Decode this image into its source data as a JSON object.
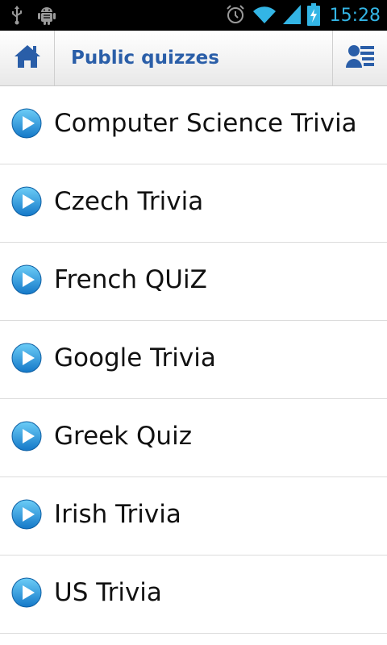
{
  "status_bar": {
    "left_icons": [
      "usb-icon",
      "android-debug-icon"
    ],
    "right_icons": [
      "alarm-icon",
      "wifi-icon",
      "signal-icon",
      "battery-charging-icon"
    ],
    "time": "15:28",
    "accent_color": "#33b5e5"
  },
  "action_bar": {
    "title": "Public quizzes",
    "home_icon": "home-icon",
    "menu_icon": "user-list-icon",
    "title_color": "#2a5ea8"
  },
  "quizzes": [
    {
      "label": "Computer Science Trivia",
      "icon": "play-icon"
    },
    {
      "label": "Czech Trivia",
      "icon": "play-icon"
    },
    {
      "label": "French QUiZ",
      "icon": "play-icon"
    },
    {
      "label": "Google Trivia",
      "icon": "play-icon"
    },
    {
      "label": "Greek Quiz",
      "icon": "play-icon"
    },
    {
      "label": "Irish Trivia",
      "icon": "play-icon"
    },
    {
      "label": "US Trivia",
      "icon": "play-icon"
    }
  ]
}
